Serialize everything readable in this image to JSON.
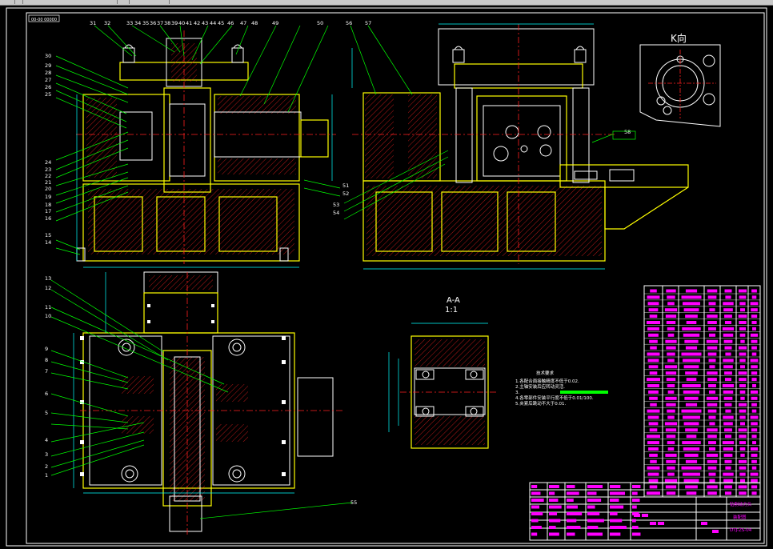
{
  "window": {
    "toolbar_present": true
  },
  "drawing": {
    "stamp_top_left": "00-00 00000",
    "view_k_label": "K向",
    "section_label": "A-A",
    "section_scale": "1:1",
    "tech_requirements_title": "技术要求",
    "tech_requirements": [
      "1.各配合面接触精度不低于0.02.",
      "2.主轴安装后应转动灵活.",
      "3.",
      "4.各零部件安装平行度不低于0.01/100.",
      "5.夹紧后跳动不大于0.01."
    ],
    "part_numbers_top": [
      "31",
      "32",
      "33",
      "34",
      "35",
      "36",
      "37",
      "38",
      "39",
      "40",
      "41",
      "42",
      "43",
      "44",
      "45",
      "46",
      "47",
      "48",
      "49",
      "50",
      "56",
      "57"
    ],
    "part_numbers_left_top": [
      "30",
      "29",
      "28",
      "27",
      "26",
      "25",
      "24",
      "23",
      "22",
      "21",
      "20",
      "19",
      "18",
      "17",
      "16",
      "15",
      "14"
    ],
    "part_numbers_right_top": [
      "51",
      "52",
      "53",
      "54",
      "58"
    ],
    "part_numbers_bottom_left": [
      "13",
      "12",
      "11",
      "10",
      "9",
      "8",
      "7",
      "6",
      "5",
      "4",
      "3",
      "2",
      "1"
    ],
    "part_number_bottom_right": "55",
    "title_block": {
      "title_line1": "钻削动力头",
      "title_line2": "装配图",
      "drawing_no": "DTJ-ZS-04",
      "colors": {
        "accent": "#ff00ff",
        "stamp": "#ff00ff"
      }
    }
  },
  "colors": {
    "background": "#000000",
    "outline": "#ffff00",
    "edges": "#ffffff",
    "centerlines": "#ff2020",
    "leaders": "#00ff00",
    "dimensions": "#00ffff",
    "bom_text": "#ff00ff"
  }
}
